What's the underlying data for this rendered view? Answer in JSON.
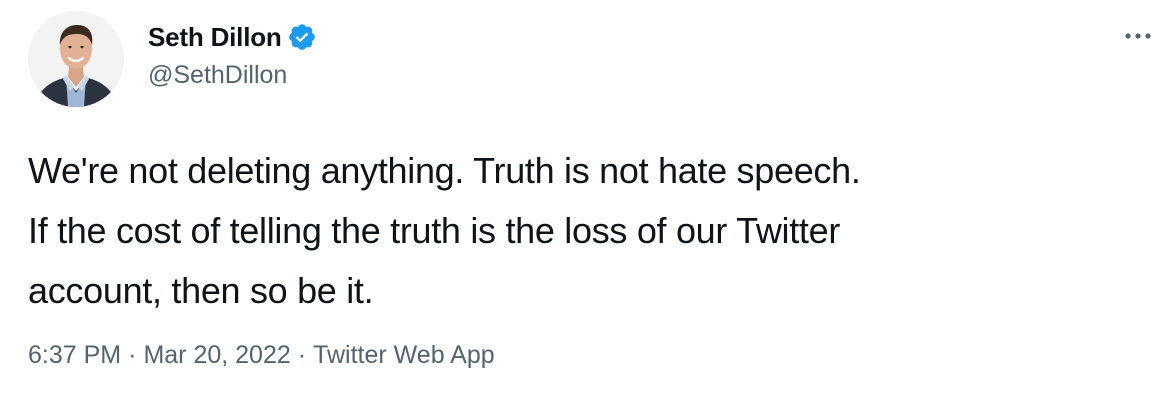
{
  "author": {
    "display_name": "Seth Dillon",
    "handle": "@SethDillon",
    "verified": true
  },
  "tweet": {
    "lines": [
      "We're not deleting anything. Truth is not hate speech.",
      "If the cost of telling the truth is the loss of our Twitter",
      "account, then so be it."
    ]
  },
  "meta": {
    "time": "6:37 PM",
    "separator": "·",
    "date": "Mar 20, 2022",
    "source": "Twitter Web App"
  },
  "icons": {
    "verified": "verified-badge-icon",
    "more": "more-options-icon"
  },
  "colors": {
    "text": "#0f1419",
    "secondary": "#536471",
    "verified_blue": "#1d9bf0",
    "background": "#ffffff"
  }
}
